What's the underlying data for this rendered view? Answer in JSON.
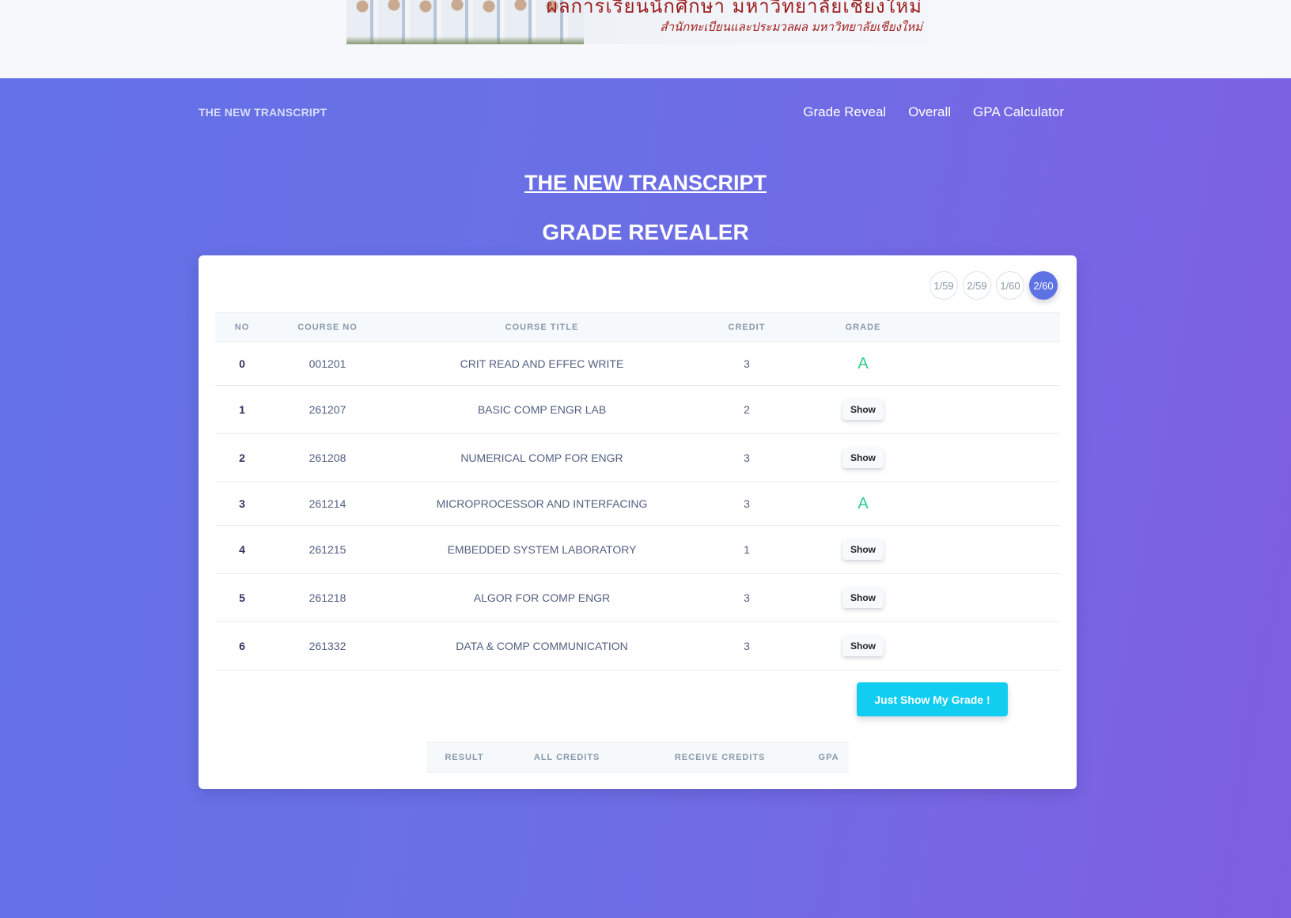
{
  "banner": {
    "title": "ผลการเรียนนักศึกษา มหาวิทยาลัยเชียงใหม่",
    "subtitle": "สำนักทะเบียนและประมวลผล มหาวิทยาลัยเชียงใหม่"
  },
  "navbar": {
    "brand": "THE NEW TRANSCRIPT",
    "links": [
      "Grade Reveal",
      "Overall",
      "GPA Calculator"
    ]
  },
  "page": {
    "title": "THE NEW TRANSCRIPT",
    "subtitle": "GRADE REVEALER"
  },
  "terms": {
    "items": [
      "1/59",
      "2/59",
      "1/60",
      "2/60"
    ],
    "active": "2/60"
  },
  "table": {
    "headers": [
      "NO",
      "COURSE NO",
      "COURSE TITLE",
      "CREDIT",
      "GRADE"
    ],
    "rows": [
      {
        "no": "0",
        "course_no": "001201",
        "title": "CRIT READ AND EFFEC WRITE",
        "credit": "3",
        "grade": "A"
      },
      {
        "no": "1",
        "course_no": "261207",
        "title": "BASIC COMP ENGR LAB",
        "credit": "2",
        "grade": null
      },
      {
        "no": "2",
        "course_no": "261208",
        "title": "NUMERICAL COMP FOR ENGR",
        "credit": "3",
        "grade": null
      },
      {
        "no": "3",
        "course_no": "261214",
        "title": "MICROPROCESSOR AND INTERFACING",
        "credit": "3",
        "grade": "A"
      },
      {
        "no": "4",
        "course_no": "261215",
        "title": "EMBEDDED SYSTEM LABORATORY",
        "credit": "1",
        "grade": null
      },
      {
        "no": "5",
        "course_no": "261218",
        "title": "ALGOR FOR COMP ENGR",
        "credit": "3",
        "grade": null
      },
      {
        "no": "6",
        "course_no": "261332",
        "title": "DATA & COMP COMMUNICATION",
        "credit": "3",
        "grade": null
      }
    ],
    "show_label": "Show"
  },
  "actions": {
    "just_show_label": "Just Show My Grade !"
  },
  "result": {
    "headers": [
      "RESULT",
      "ALL CREDITS",
      "RECEIVE CREDITS",
      "GPA"
    ]
  },
  "colors": {
    "accent": "#5e72e4",
    "grade_a": "#2dce89",
    "info_button": "#11cdef",
    "hero_start": "#6471e6",
    "hero_end": "#7f5fe2"
  }
}
